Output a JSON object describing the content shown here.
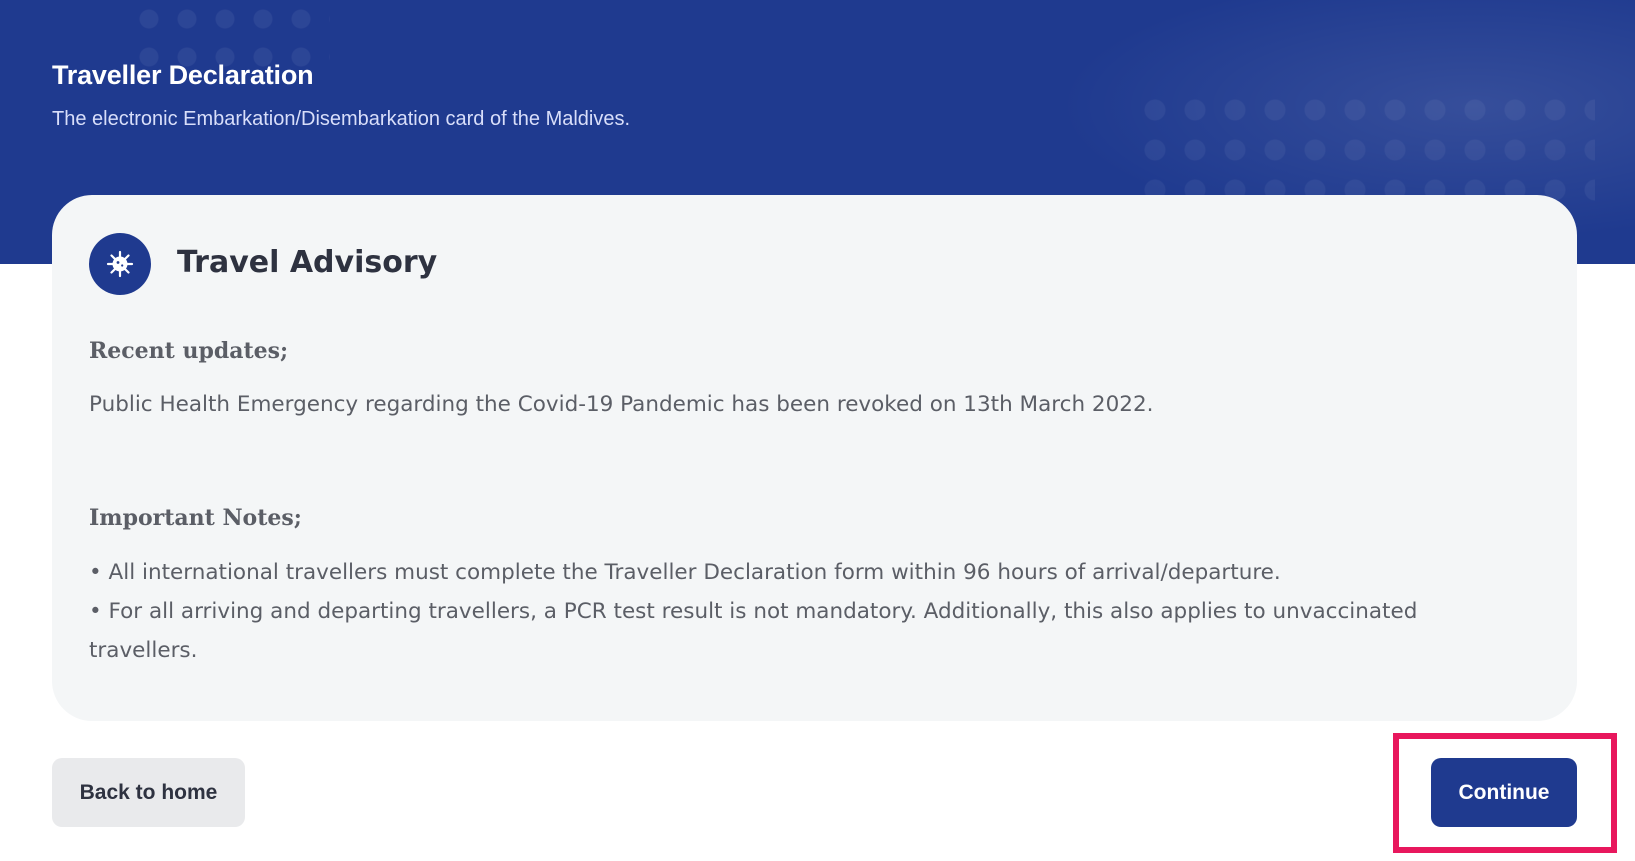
{
  "header": {
    "title": "Traveller Declaration",
    "subtitle": "The electronic Embarkation/Disembarkation card of the Maldives."
  },
  "advisory": {
    "icon": "virus-icon",
    "title": "Travel Advisory",
    "recent_heading": "Recent updates;",
    "recent_text": "Public Health Emergency regarding the Covid-19 Pandemic has been revoked on 13th March 2022.",
    "notes_heading": "Important Notes;",
    "notes": [
      "• All international travellers must complete the Traveller Declaration form within 96 hours of arrival/departure.",
      "• For all arriving and departing travellers, a PCR test result is not mandatory. Additionally, this also applies to unvaccinated travellers."
    ]
  },
  "actions": {
    "back_label": "Back to home",
    "continue_label": "Continue"
  },
  "colors": {
    "brand": "#1f3a8f",
    "highlight": "#e8175d",
    "card_bg": "#f4f6f7"
  }
}
